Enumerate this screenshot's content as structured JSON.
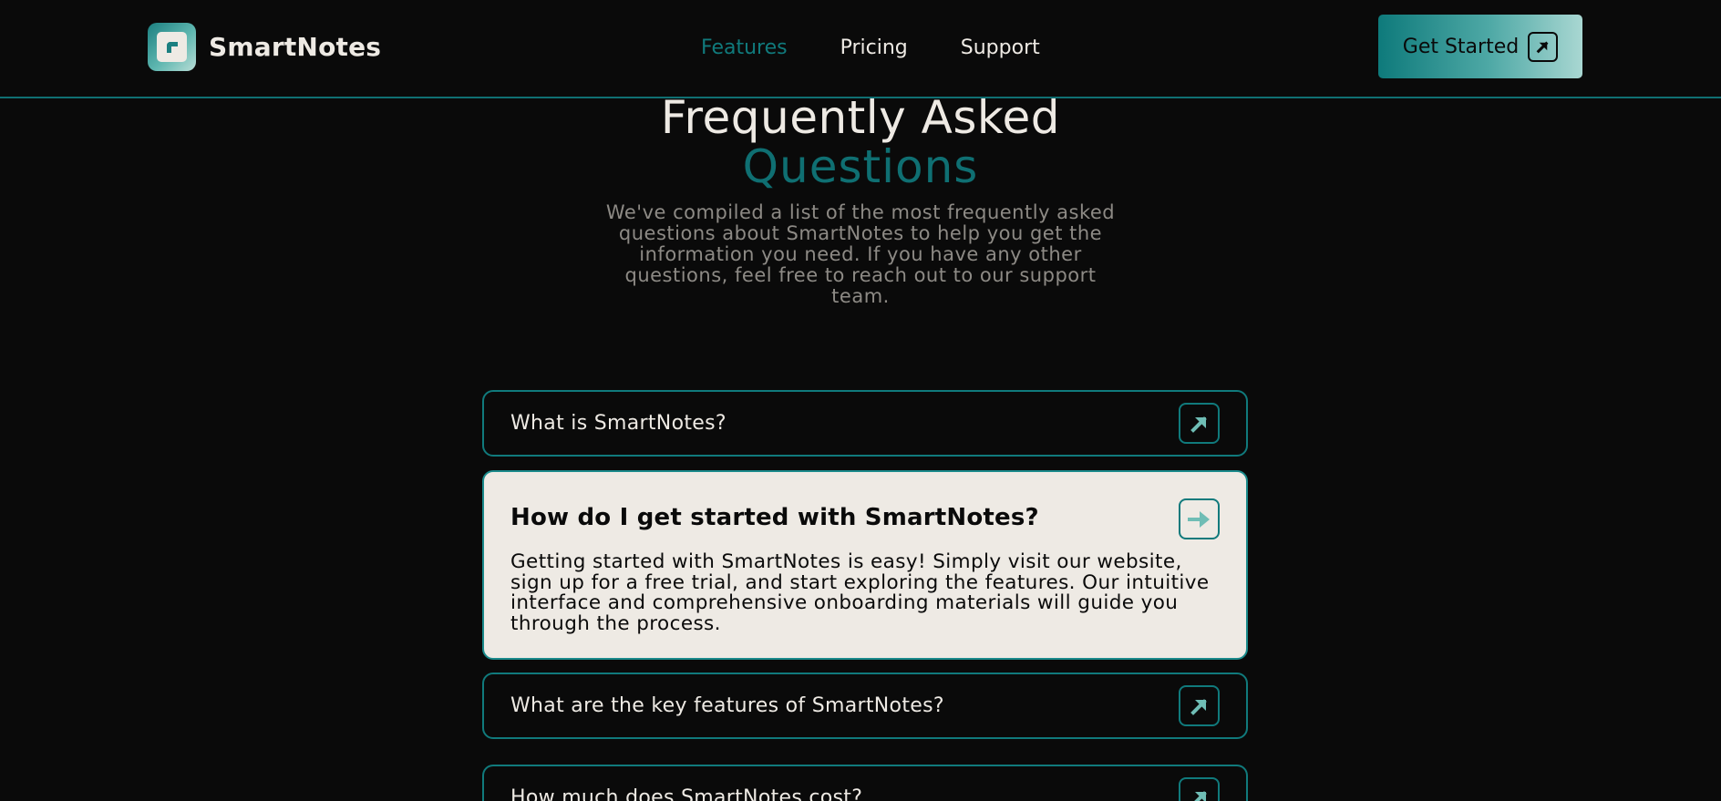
{
  "header": {
    "brand": "SmartNotes",
    "nav": [
      {
        "label": "Features",
        "active": true
      },
      {
        "label": "Pricing",
        "active": false
      },
      {
        "label": "Support",
        "active": false
      }
    ],
    "cta_label": "Get Started"
  },
  "hero": {
    "title_line1": "Frequently Asked",
    "title_line2": "Questions",
    "description": "We've compiled a list of the most frequently asked questions about SmartNotes to help you get the information you need. If you have any other questions, feel free to reach out to our support team."
  },
  "faq": [
    {
      "question": "What is SmartNotes?",
      "open": false
    },
    {
      "question": "How do I get started with SmartNotes?",
      "open": true,
      "answer": "Getting started with SmartNotes is easy! Simply visit our website, sign up for a free trial, and start exploring the features. Our intuitive interface and comprehensive onboarding materials will guide you through the process."
    },
    {
      "question": "What are the key features of SmartNotes?",
      "open": false
    },
    {
      "question": "How much does SmartNotes cost?",
      "open": false
    }
  ],
  "colors": {
    "background": "#0a0a0a",
    "accent": "#107a7c",
    "text": "#eeeae4",
    "muted": "#8d8a85"
  },
  "icons": {
    "logo": "note-logo-icon",
    "cta": "arrow-up-right-icon",
    "faq_closed": "arrow-up-right-icon",
    "faq_open": "arrow-right-icon"
  }
}
